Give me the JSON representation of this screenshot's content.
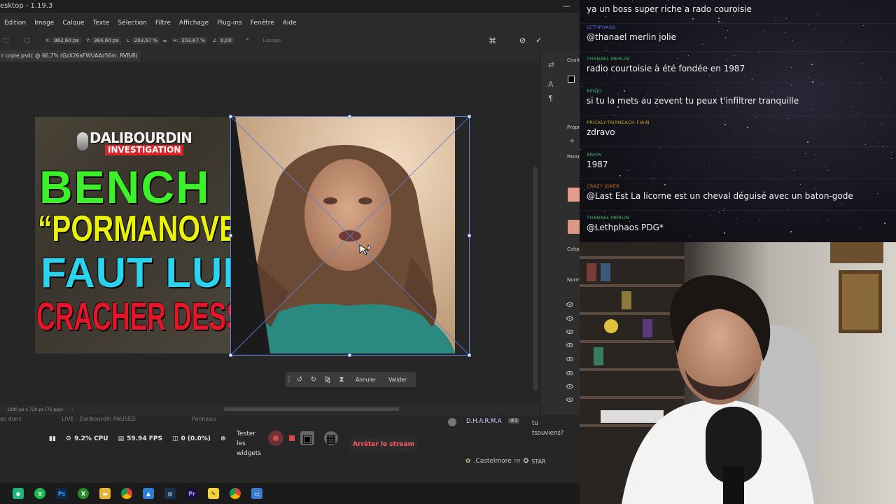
{
  "photoshop": {
    "window_title": "esktop - 1.19.3",
    "menu": [
      "Edition",
      "Image",
      "Calque",
      "Texte",
      "Sélection",
      "Filtre",
      "Affichage",
      "Plug-ins",
      "Fenêtre",
      "Aide"
    ],
    "options": {
      "x_label": "X:",
      "x_value": "962,60 px",
      "y_label": "Y:",
      "y_value": "364,60 px",
      "l_label": "L:",
      "l_value": "203,67 %",
      "h_label": "H:",
      "h_value": "203,67 %",
      "angle_value": "0,00",
      "smoothing_label": "Lissage"
    },
    "doc_tab": "r copie.psdc @ 66,7% (GzX26aFWUAAz56m, RVB/8)",
    "doc_tab_close": "×",
    "status": "1280 px x 720 px (72 ppp)",
    "right_panel": {
      "couleur": "Coule",
      "proprietes": "Propr",
      "parametres": "Parar",
      "calques": "Calqu",
      "normal": "Norm"
    },
    "thumbnail": {
      "logo_top": "DALIBOURDIN",
      "logo_bottom": "INVESTIGATION",
      "line1": "BENCH",
      "line2": "“PORMANOVE",
      "line3": "FAUT LUI",
      "line4": "CRACHER DESSUS”"
    },
    "transform_toolbar": {
      "cancel": "Annuler",
      "validate": "Valider"
    }
  },
  "obs": {
    "tab_dons": "es dons",
    "tab_live": "LIVE - Dalibourdin PAUSED",
    "tab_panneau": "Panneau",
    "cpu": "9.2% CPU",
    "fps": "59.94 FPS",
    "dropped": "0 (0.0%)",
    "widgets_text": "Tester les widgets",
    "stop_stream": "Arrêter le stream",
    "chat_user": "D.H.A.R.M.A",
    "chat_badge": "#3",
    "chat_msg": "tu tsouviens?",
    "bottom_user": ".Castelmore",
    "bottom_badge": "FR",
    "bottom_star": "STAR"
  },
  "taskbar": {
    "icons": [
      "obs-icon",
      "spotify-icon",
      "photoshop-icon",
      "xbox-icon",
      "folder-icon",
      "chrome-icon",
      "photos-icon",
      "steam-icon",
      "premiere-icon",
      "notes-icon",
      "chrome-canary-icon",
      "window-icon"
    ]
  },
  "chat": {
    "messages": [
      {
        "user": "",
        "text": "ya un boss super riche a rado couroisie",
        "color": "#7a8cff"
      },
      {
        "user": "LETHPHAOS",
        "text": "@thanael merlin jolie",
        "color": "#5a78ff"
      },
      {
        "user": "THANAEL MERLIN",
        "text": "radio courtoisie à été fondée en 1987",
        "color": "#3fbf6a"
      },
      {
        "user": "BENJO",
        "text": "si tu la mets au zevent tu peux t'infiltrer tranquille",
        "color": "#3fbf6a"
      },
      {
        "user": "PRICKLY-TAIRNEACH FIÁIN",
        "text": "zdravo",
        "color": "#c9a41b"
      },
      {
        "user": "ARKIN",
        "text": "1987",
        "color": "#3fbf6a"
      },
      {
        "user": "CRAZY JOKER",
        "text": "@Last Est La licorne est un cheval déguisé avec un baton-gode",
        "color": "#d96f1f"
      },
      {
        "user": "THANAEL MERLIN",
        "text": "@Lethphaos PDG*",
        "color": "#3fbf6a"
      }
    ]
  }
}
